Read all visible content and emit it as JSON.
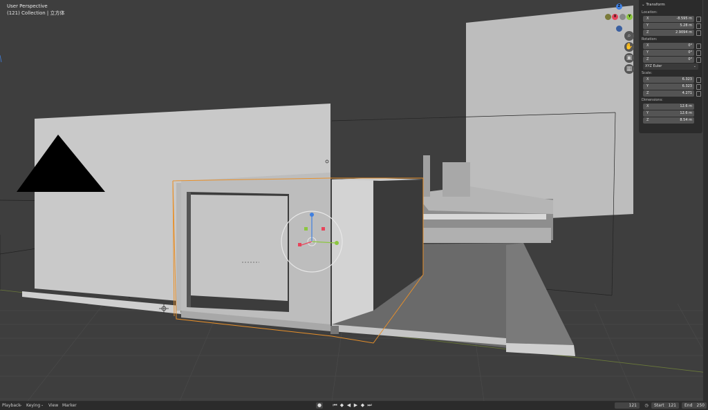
{
  "viewport": {
    "title": "User Perspective",
    "collection": "(121) Collection | 立方体"
  },
  "gizmo": {
    "z_label": "Z",
    "x_label": "X",
    "y_label": "Y"
  },
  "nav_icons": [
    "zoom-icon",
    "hand-icon",
    "camera-icon",
    "grid-icon"
  ],
  "panel": {
    "header": "Transform",
    "location_label": "Location:",
    "location": [
      {
        "axis": "X",
        "value": "-8.595 m"
      },
      {
        "axis": "Y",
        "value": "5.28 m"
      },
      {
        "axis": "Z",
        "value": "2.9094 m"
      }
    ],
    "rotation_label": "Rotation:",
    "rotation": [
      {
        "axis": "X",
        "value": "0°"
      },
      {
        "axis": "Y",
        "value": "0°"
      },
      {
        "axis": "Z",
        "value": "0°"
      }
    ],
    "rotation_mode": "XYZ Euler",
    "scale_label": "Scale:",
    "scale": [
      {
        "axis": "X",
        "value": "6.323"
      },
      {
        "axis": "Y",
        "value": "6.323"
      },
      {
        "axis": "Z",
        "value": "4.271"
      }
    ],
    "dimensions_label": "Dimensions:",
    "dimensions": [
      {
        "axis": "X",
        "value": "12.6 m"
      },
      {
        "axis": "Y",
        "value": "12.6 m"
      },
      {
        "axis": "Z",
        "value": "8.54 m"
      }
    ]
  },
  "timeline": {
    "playback": "Playback",
    "keying": "Keying",
    "view": "View",
    "marker": "Marker",
    "current_frame": "121",
    "start_label": "Start",
    "start_value": "121",
    "end_label": "End",
    "end_value": "250"
  },
  "colors": {
    "background": "#3e3e3e",
    "panel": "#2b2b2b",
    "selection_orange": "#e8902a",
    "axis_x": "#e8445a",
    "axis_y": "#8cc63f",
    "axis_z": "#3f7fe0"
  }
}
